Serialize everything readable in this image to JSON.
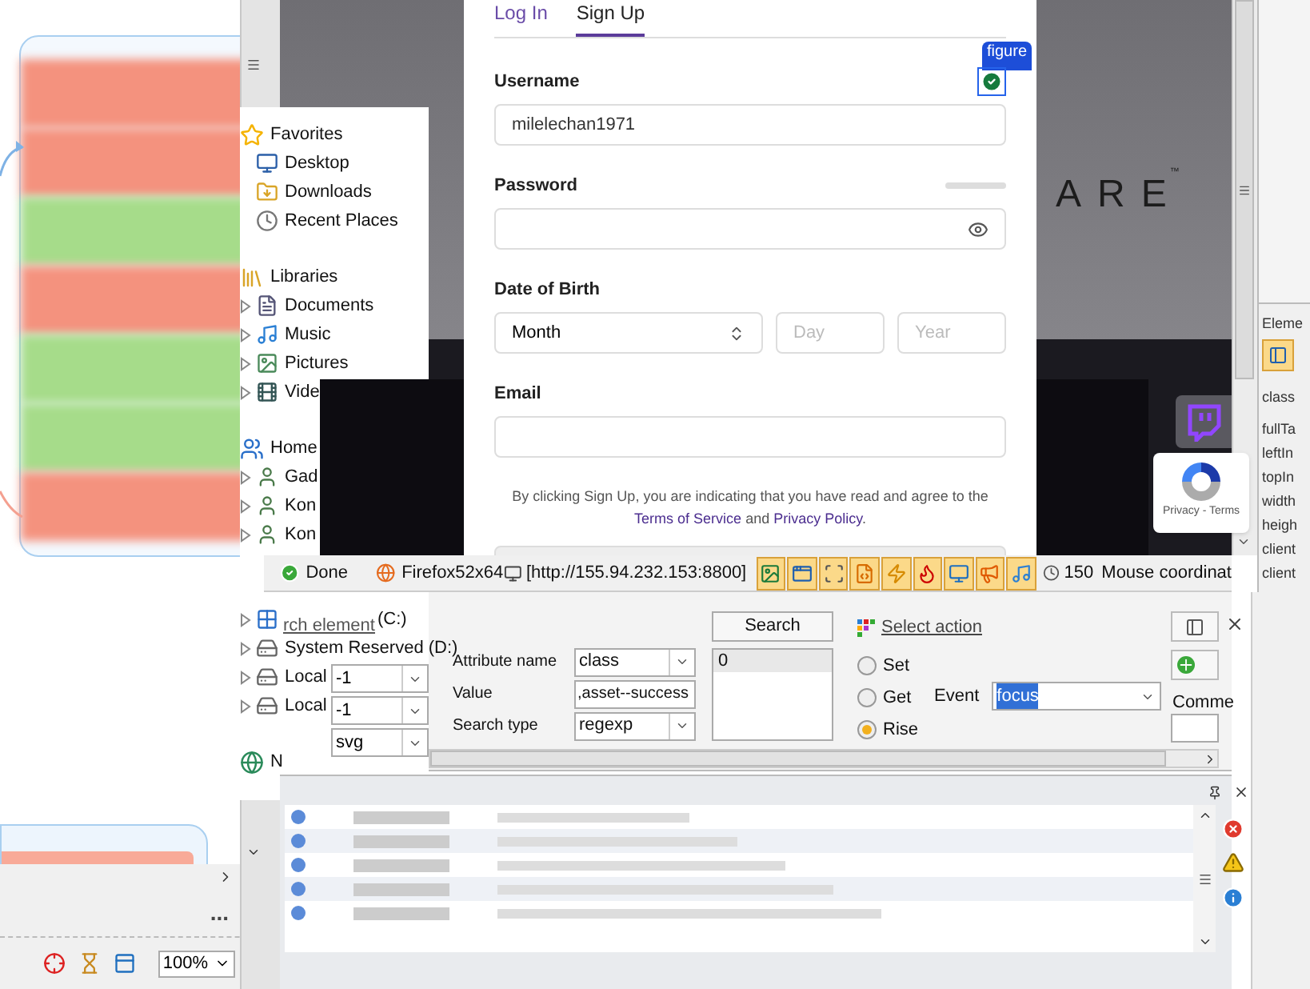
{
  "left_pane": {
    "rows": [
      {
        "color": "#f4927e"
      },
      {
        "color": "#f4927e"
      },
      {
        "color": "#a6dc8a"
      },
      {
        "color": "#f4927e"
      },
      {
        "color": "#a6dc8a"
      },
      {
        "color": "#a6dc8a"
      },
      {
        "color": "#f4927e"
      }
    ],
    "more": "...",
    "zoom": "100%"
  },
  "explorer": {
    "groups": [
      {
        "label": "Favorites",
        "kind": "star",
        "items": [
          {
            "label": "Desktop",
            "kind": "desktop"
          },
          {
            "label": "Downloads",
            "kind": "download"
          },
          {
            "label": "Recent Places",
            "kind": "recent"
          }
        ]
      },
      {
        "label": "Libraries",
        "kind": "library",
        "items": [
          {
            "label": "Documents",
            "kind": "document",
            "expanded": false
          },
          {
            "label": "Music",
            "kind": "music",
            "expanded": false
          },
          {
            "label": "Pictures",
            "kind": "picture",
            "expanded": false
          },
          {
            "label": "Vide",
            "kind": "video",
            "expanded": false
          }
        ]
      },
      {
        "label": "Home",
        "kind": "homegroup",
        "items": [
          {
            "label": "Gad",
            "kind": "user",
            "expanded": false
          },
          {
            "label": "Kon",
            "kind": "user",
            "expanded": false
          },
          {
            "label": "Kon",
            "kind": "user",
            "expanded": false
          }
        ]
      },
      {
        "kind": "computer",
        "items": [
          {
            "label": "(C:)",
            "kind": "windows",
            "expanded": false
          },
          {
            "label": "System Reserved (D:)",
            "kind": "disk",
            "expanded": false
          },
          {
            "label": "Local",
            "kind": "disk",
            "expanded": false
          },
          {
            "label": "Local",
            "kind": "disk",
            "expanded": false
          }
        ]
      },
      {
        "label": "N",
        "kind": "network"
      }
    ]
  },
  "browser": {
    "logo": "ARE",
    "logo_mark": "™",
    "recaptcha": "Privacy - Terms"
  },
  "signup": {
    "tabs": [
      {
        "label": "Log In",
        "selected": false
      },
      {
        "label": "Sign Up",
        "selected": true
      }
    ],
    "tag": "figure",
    "fields": [
      {
        "kind": "text",
        "label": "Username",
        "value": "milelechan1971",
        "valid": true
      },
      {
        "kind": "password",
        "label": "Password"
      },
      {
        "kind": "date",
        "label": "Date of Birth",
        "month": "Month",
        "day_placeholder": "Day",
        "year_placeholder": "Year"
      },
      {
        "kind": "text",
        "label": "Email"
      }
    ],
    "terms": {
      "text": "By clicking Sign Up, you are indicating that you have read and agree to the",
      "links": [
        "Terms of Service",
        "Privacy Policy"
      ],
      "joiner": "and",
      "end": "."
    }
  },
  "status_bar": {
    "status": "Done",
    "browser": "Firefox52x64",
    "address": "[http://155.94.232.153:8800]",
    "tools": [
      {
        "kind": "image",
        "selected": true
      },
      {
        "kind": "window",
        "selected": true
      },
      {
        "kind": "frame",
        "selected": true
      },
      {
        "kind": "css",
        "selected": true
      },
      {
        "kind": "flash",
        "selected": true
      },
      {
        "kind": "flame",
        "selected": true
      },
      {
        "kind": "monitor",
        "selected": true
      },
      {
        "kind": "megaphone",
        "selected": true
      },
      {
        "kind": "music",
        "selected": true
      }
    ],
    "timer": "150",
    "mouse": "Mouse coordinat"
  },
  "inspector": {
    "filters": [
      "-1",
      "-1",
      "svg"
    ],
    "link": "rch element",
    "search_button": "Search",
    "attributes": [
      {
        "label": "Attribute name",
        "value": "class",
        "kind": "select"
      },
      {
        "label": "Value",
        "value": ",asset--success",
        "kind": "input"
      },
      {
        "label": "Search type",
        "value": "regexp",
        "kind": "select"
      }
    ],
    "results": [
      {
        "text": "0",
        "selected": true
      }
    ],
    "action_link": "Select action",
    "modes": [
      {
        "label": "Set",
        "selected": false
      },
      {
        "label": "Get",
        "selected": false
      },
      {
        "label": "Rise",
        "selected": true
      }
    ],
    "event": {
      "label": "Event",
      "value": "focus"
    },
    "comment_label": "Comme"
  },
  "properties": {
    "title": "Eleme",
    "header": "class",
    "rows": [
      "fullTa",
      "leftIn",
      "topIn",
      "width",
      "heigh",
      "client",
      "client"
    ]
  }
}
